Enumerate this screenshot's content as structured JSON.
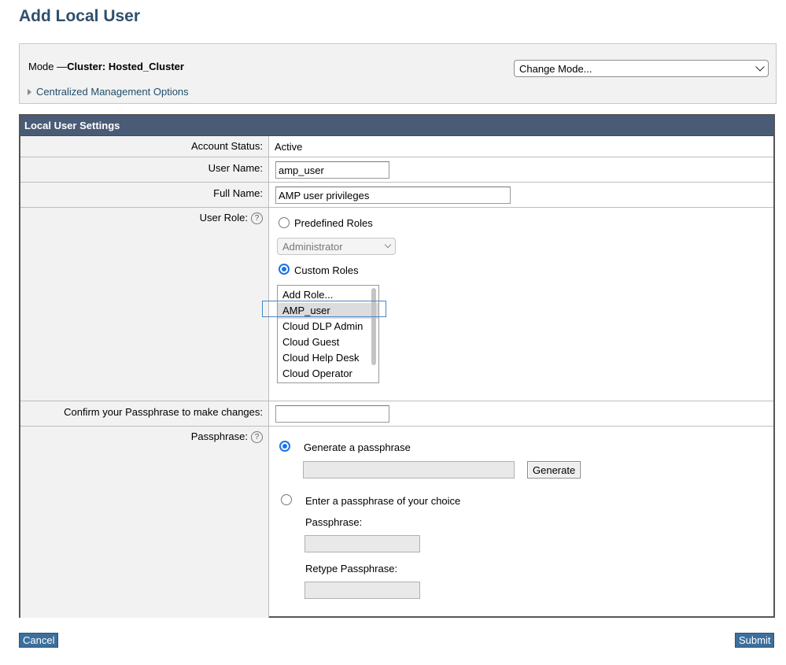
{
  "page": {
    "title": "Add Local User"
  },
  "mode": {
    "prefix": "Mode —",
    "value": "Cluster: Hosted_Cluster",
    "change_mode_label": "Change Mode...",
    "centralized_options_label": "Centralized Management Options"
  },
  "settings": {
    "header": "Local User Settings",
    "account_status": {
      "label": "Account Status:",
      "value": "Active"
    },
    "user_name": {
      "label": "User Name:",
      "value": "amp_user"
    },
    "full_name": {
      "label": "Full Name:",
      "value": "AMP user privileges"
    },
    "user_role": {
      "label": "User Role:",
      "predefined_label": "Predefined Roles",
      "predefined_selected": "Administrator",
      "custom_label": "Custom Roles",
      "custom_options": [
        "Add Role...",
        "AMP_user",
        "Cloud DLP Admin",
        "Cloud Guest",
        "Cloud Help Desk",
        "Cloud Operator"
      ],
      "selected_index": 1
    },
    "confirm": {
      "label": "Confirm your Passphrase to make changes:",
      "value": ""
    },
    "passphrase": {
      "label": "Passphrase:",
      "generate_label": "Generate a passphrase",
      "generate_button": "Generate",
      "choose_label": "Enter a passphrase of your choice",
      "passphrase_label": "Passphrase:",
      "retype_label": "Retype Passphrase:"
    }
  },
  "actions": {
    "cancel": "Cancel",
    "submit": "Submit"
  },
  "icons": {
    "help": "?"
  },
  "colors": {
    "title": "#2f4f6b",
    "header_bg": "#4a5b76",
    "accent": "#1a73e8",
    "button": "#3c6f9c"
  }
}
